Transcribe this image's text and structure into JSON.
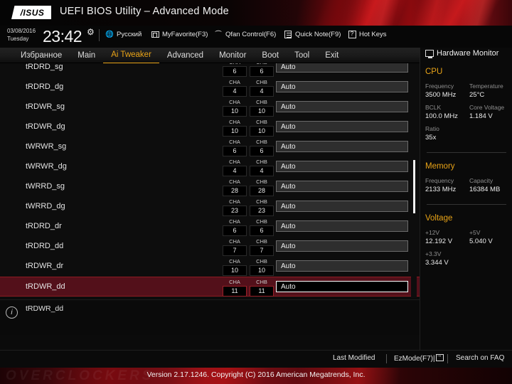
{
  "banner": {
    "logo": "/ISUS",
    "title": "UEFI BIOS Utility – Advanced Mode"
  },
  "utilbar": {
    "date": "03/08/2016",
    "weekday": "Tuesday",
    "time": "23:42",
    "gear_icon": "gear-icon",
    "items": [
      {
        "label": "Русский",
        "icon": "globe-icon"
      },
      {
        "label": "MyFavorite(F3)",
        "icon": "favorite-icon"
      },
      {
        "label": "Qfan Control(F6)",
        "icon": "fan-icon"
      },
      {
        "label": "Quick Note(F9)",
        "icon": "note-icon"
      },
      {
        "label": "Hot Keys",
        "icon": "question-icon"
      }
    ]
  },
  "nav": {
    "tabs": [
      {
        "label": "Избранное",
        "active": false
      },
      {
        "label": "Main",
        "active": false
      },
      {
        "label": "Ai Tweaker",
        "active": true
      },
      {
        "label": "Advanced",
        "active": false
      },
      {
        "label": "Monitor",
        "active": false
      },
      {
        "label": "Boot",
        "active": false
      },
      {
        "label": "Tool",
        "active": false
      },
      {
        "label": "Exit",
        "active": false
      }
    ],
    "accent_color": "#e8a317"
  },
  "list": {
    "channel_a_label": "CHA",
    "channel_b_label": "CHB",
    "rows": [
      {
        "label": "tRDRD_sg",
        "cha": "6",
        "chb": "6",
        "value": "Auto",
        "selected": false,
        "clipped": true
      },
      {
        "label": "tRDRD_dg",
        "cha": "4",
        "chb": "4",
        "value": "Auto",
        "selected": false,
        "clipped": false
      },
      {
        "label": "tRDWR_sg",
        "cha": "10",
        "chb": "10",
        "value": "Auto",
        "selected": false,
        "clipped": false
      },
      {
        "label": "tRDWR_dg",
        "cha": "10",
        "chb": "10",
        "value": "Auto",
        "selected": false,
        "clipped": false
      },
      {
        "label": "tWRWR_sg",
        "cha": "6",
        "chb": "6",
        "value": "Auto",
        "selected": false,
        "clipped": false
      },
      {
        "label": "tWRWR_dg",
        "cha": "4",
        "chb": "4",
        "value": "Auto",
        "selected": false,
        "clipped": false
      },
      {
        "label": "tWRRD_sg",
        "cha": "28",
        "chb": "28",
        "value": "Auto",
        "selected": false,
        "clipped": false
      },
      {
        "label": "tWRRD_dg",
        "cha": "23",
        "chb": "23",
        "value": "Auto",
        "selected": false,
        "clipped": false
      },
      {
        "label": "tRDRD_dr",
        "cha": "6",
        "chb": "6",
        "value": "Auto",
        "selected": false,
        "clipped": false
      },
      {
        "label": "tRDRD_dd",
        "cha": "7",
        "chb": "7",
        "value": "Auto",
        "selected": false,
        "clipped": false
      },
      {
        "label": "tRDWR_dr",
        "cha": "10",
        "chb": "10",
        "value": "Auto",
        "selected": false,
        "clipped": false
      },
      {
        "label": "tRDWR_dd",
        "cha": "11",
        "chb": "11",
        "value": "Auto",
        "selected": true,
        "clipped": false
      }
    ]
  },
  "help": {
    "icon": "info-icon",
    "text": "tRDWR_dd"
  },
  "sidebar": {
    "title": "Hardware Monitor",
    "title_icon": "monitor-icon",
    "sections": [
      {
        "heading": "CPU",
        "fields": [
          {
            "label": "Frequency",
            "value": "3500 MHz"
          },
          {
            "label": "Temperature",
            "value": "25°C"
          },
          {
            "label": "BCLK",
            "value": "100.0 MHz"
          },
          {
            "label": "Core Voltage",
            "value": "1.184 V"
          },
          {
            "label": "Ratio",
            "value": "35x"
          }
        ]
      },
      {
        "heading": "Memory",
        "fields": [
          {
            "label": "Frequency",
            "value": "2133 MHz"
          },
          {
            "label": "Capacity",
            "value": "16384 MB"
          }
        ]
      },
      {
        "heading": "Voltage",
        "fields": [
          {
            "label": "+12V",
            "value": "12.192 V"
          },
          {
            "label": "+5V",
            "value": "5.040 V"
          },
          {
            "label": "+3.3V",
            "value": "3.344 V"
          }
        ]
      }
    ]
  },
  "bottombar": {
    "last_modified": "Last Modified",
    "ezmode": "EzMode(F7)|",
    "ezmode_icon": "arrow-right-box-icon",
    "search_faq": "Search on FAQ"
  },
  "footer": {
    "watermark": "OVERCLOCKERS",
    "version": "Version 2.17.1246. Copyright (C) 2016 American Megatrends, Inc."
  }
}
